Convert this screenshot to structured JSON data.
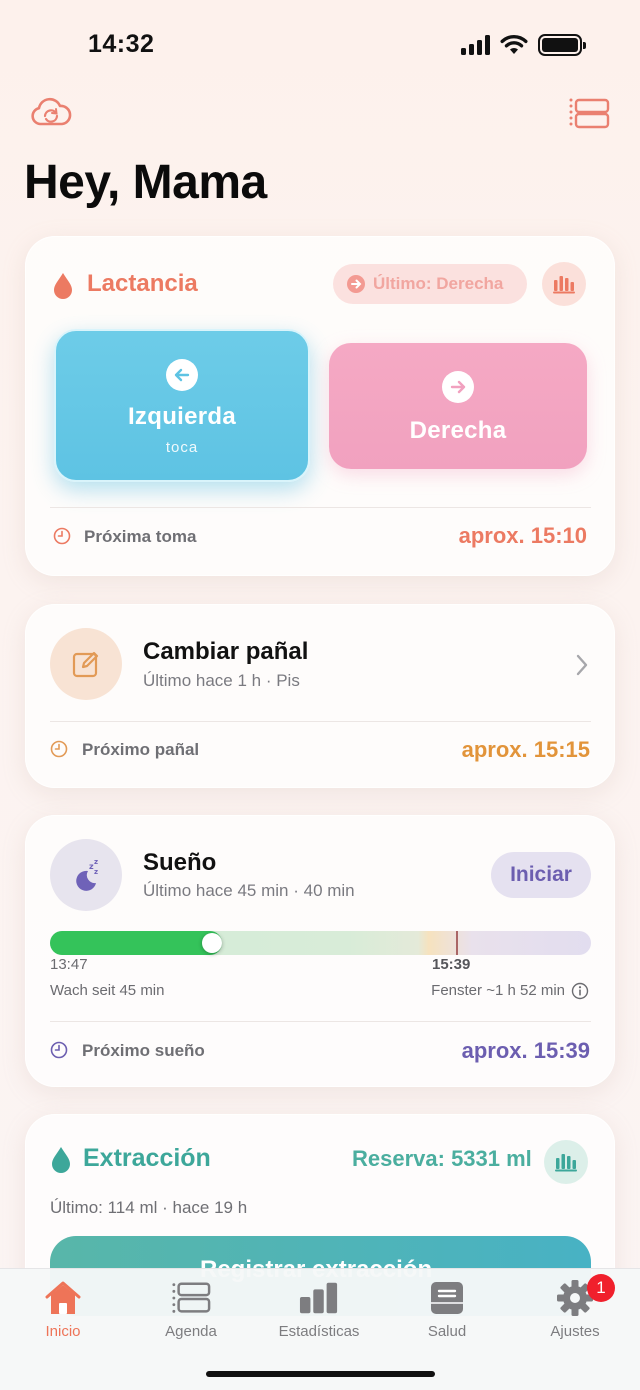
{
  "status_bar": {
    "time": "14:32"
  },
  "greeting": "Hey, Mama",
  "lactation": {
    "title": "Lactancia",
    "last_pill": "Último: Derecha",
    "left_button": {
      "label": "Izquierda",
      "hint": "toca"
    },
    "right_button": {
      "label": "Derecha"
    },
    "next_label": "Próxima toma",
    "next_value": "aprox. 15:10",
    "accent_color": "#ec7a62"
  },
  "diaper": {
    "title": "Cambiar pañal",
    "subtitle": "Último hace 1 h · Pis",
    "next_label": "Próximo pañal",
    "next_value": "aprox. 15:15",
    "accent_color": "#e2943a"
  },
  "sleep": {
    "title": "Sueño",
    "subtitle": "Último hace 45 min · 40 min",
    "start_button": "Iniciar",
    "timeline": {
      "start_time": "13:47",
      "window_time": "15:39",
      "awake_text": "Wach seit 45 min",
      "window_text": "Fenster ~1 h 52 min",
      "progress": 0.3,
      "marker": 0.75
    },
    "next_label": "Próximo sueño",
    "next_value": "aprox. 15:39",
    "accent_color": "#6c5eb0"
  },
  "extraction": {
    "title": "Extracción",
    "reserve": "Reserva: 5331 ml",
    "last": "Último: 114 ml · hace 19 h",
    "button_label": "Registrar extracción",
    "accent_color": "#3da79a"
  },
  "tabbar": {
    "tabs": [
      {
        "label": "Inicio",
        "icon": "home-icon",
        "active": true
      },
      {
        "label": "Agenda",
        "icon": "agenda-icon"
      },
      {
        "label": "Estadísticas",
        "icon": "bar-chart-icon"
      },
      {
        "label": "Salud",
        "icon": "health-icon"
      },
      {
        "label": "Ajustes",
        "icon": "gear-icon"
      }
    ],
    "settings_badge": "1"
  }
}
